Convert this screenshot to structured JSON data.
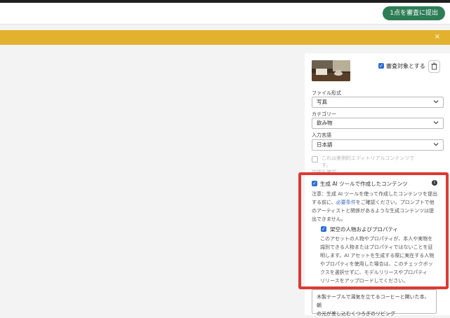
{
  "header": {
    "submit_button": "1点を審査に提出"
  },
  "banner": {
    "close_glyph": "×",
    "color": "#e2b22f"
  },
  "asset": {
    "review_label": "審査対象とする",
    "review_checked": true
  },
  "fields": {
    "file_type": {
      "label": "ファイル形式",
      "value": "写真"
    },
    "category": {
      "label": "カテゴリー",
      "value": "飲み物"
    },
    "language": {
      "label": "入力言語",
      "value": "日本語"
    }
  },
  "editorial": {
    "line1": "これは実例的エディトリアルコンテンツで",
    "line2": "す。",
    "link": "詳細を確認",
    "checked": false
  },
  "generative_ai": {
    "title": "生成 AI ツールで作成したコンテンツ",
    "checked": true,
    "note_line1": "注意：生成 AI ツールを使って作成したコンテンツを提出",
    "note_line2_before": "する前に、",
    "note_line2_link": "必要条件",
    "note_line2_after": "をご確認ください。プロンプトで他",
    "note_line3": "のアーティストと関係があるような生成コンテンツは提",
    "note_line4": "出できません。",
    "fictional": {
      "title": "架空の人物およびプロパティ",
      "checked": true,
      "line1": "このアセットの人物やプロパティが、本人や実物を",
      "line2": "識別できる人物またはプロパティではないことを証",
      "line3": "明します。AI アセットを生成する際に実在する人物",
      "line4": "やプロパティを使用した場合は、このチェックボッ",
      "line5": "クスを選択せずに、モデルリリースやプロパティ",
      "line6": "リリースをアップロードしてください。"
    }
  },
  "description": {
    "line1": "木製テーブルで湯気を立てるコーヒーと開いた本、朝",
    "line2": "の光が差し込むくつろぎのリビング"
  },
  "colors": {
    "accent_green": "#2d7d56",
    "checkbox_blue": "#2c6fd1",
    "highlight_red": "#dc3a35"
  }
}
